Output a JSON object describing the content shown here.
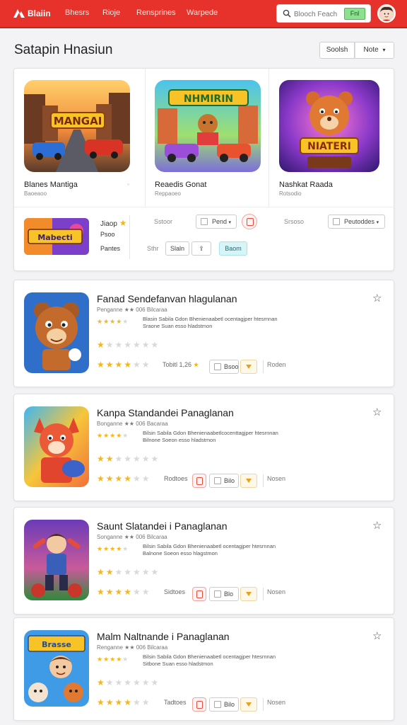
{
  "header": {
    "brand": "Blaiin",
    "nav": [
      "Bhesrs",
      "Rioje",
      "Rensprines",
      "Warpede"
    ],
    "search_placeholder": "Blooch Feach",
    "search_button": "Fnl",
    "accent_color": "#e7322b"
  },
  "title_row": {
    "title": "Satapin Hnasiun",
    "filter_label": "Soolsh",
    "sort_label": "Note"
  },
  "featured": {
    "cards": [
      {
        "title": "Blanes Mantiga",
        "subtitle": "Baoeaoo",
        "image_text": "MANGAI",
        "icon": "racing-game-thumbnail"
      },
      {
        "title": "Reaedis Gonat",
        "subtitle": "Reppaoeo",
        "image_text": "NHMIRIN",
        "icon": "kart-game-thumbnail"
      },
      {
        "title": "Nashkat Raada",
        "subtitle": "Rotsodio",
        "image_text": "NIATERI",
        "icon": "bear-game-thumbnail"
      }
    ],
    "mini": {
      "image_text": "Mabecti",
      "label_1": "Jiaop",
      "label_2": "Psoo",
      "label_3": "Pantes"
    },
    "controls": {
      "label_a": "Sstoor",
      "pill_a": "Pend",
      "label_b": "Srsoso",
      "pill_b": "Peutoddes",
      "label_c": "Sthr",
      "pill_c": "Slaln",
      "chip": "Baom"
    }
  },
  "list": [
    {
      "title": "Fanad Sendefanvan hlagulanan",
      "meta": "Penganne ★★ 006 Bilcaraa",
      "desc_1": "Blasin Sabila Gdon Bhenienaabetl ocentagjper htesrnnan",
      "desc_2": "Sraone Suan esso hladstmon",
      "count": "Tobitl 1,26",
      "button": "Bsoo",
      "action": "Roden",
      "rating_a": 1,
      "rating_b": 4
    },
    {
      "title": "Kanpa Standandei Panaglanan",
      "meta": "Bonganne ★★ 006 Bacaraa",
      "desc_1": "Bilsin Sabila Gdon Bhenienaabetlcocenttagjper htesrnnan",
      "desc_2": "Bilnone Soeon esso hladstmon",
      "count": "Rodtoes",
      "button": "Bilo",
      "action": "Nosen",
      "rating_a": 2,
      "rating_b": 4
    },
    {
      "title": "Saunt Slatandei i Panaglanan",
      "meta": "Songanne ★★ 006 Bilcaraa",
      "desc_1": "Bilsin Sabila Gdon Bhenienaabetl ocentagjper htesrnnan",
      "desc_2": "Balnone Soeon esso hlagstmon",
      "count": "Sidtoes",
      "button": "Blo",
      "action": "Nosen",
      "rating_a": 2,
      "rating_b": 4
    },
    {
      "title": "Malm Naltnande i Panaglanan",
      "meta": "Renganne ★★ 006 Bilcaraa",
      "desc_1": "Bilsin Sabila Gdon Bhenienaabetl ocentagjper htesrnnan",
      "desc_2": "Sitbone Suan esso hladstmon",
      "count": "Tadtoes",
      "button": "Bilo",
      "action": "Nosen",
      "rating_a": 1,
      "rating_b": 4
    }
  ],
  "list_icons": [
    "bear-character-icon",
    "fox-character-icon",
    "hero-character-icon",
    "kids-character-icon"
  ]
}
